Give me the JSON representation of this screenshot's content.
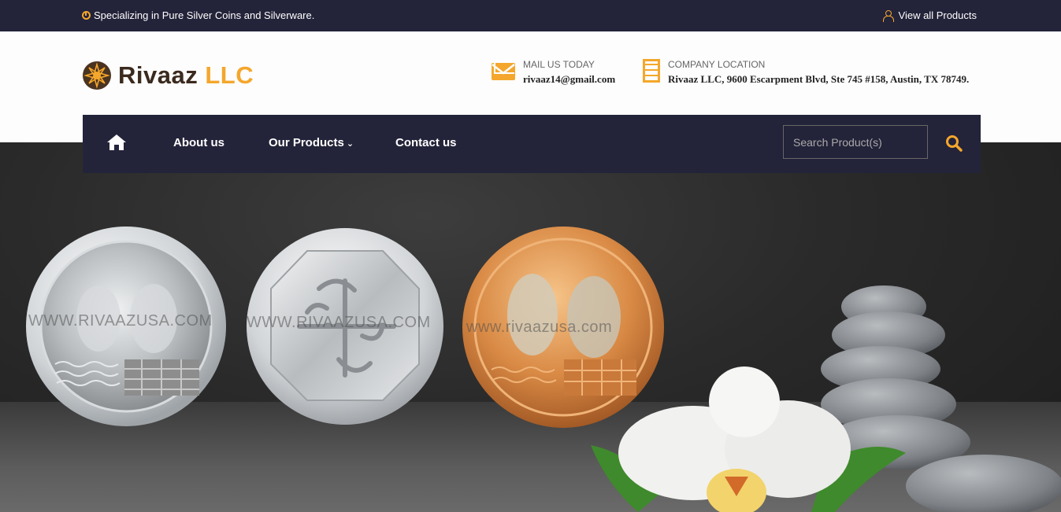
{
  "topbar": {
    "tagline": "Specializing in Pure Silver Coins and Silverware.",
    "view_products": "View all Products"
  },
  "brand": {
    "name_part1": "Rivaaz",
    "name_part2": "LLC"
  },
  "contact": {
    "mail_label": "MAIL US TODAY",
    "mail_value": "rivaaz14@gmail.com",
    "location_label": "COMPANY LOCATION",
    "location_value": "Rivaaz LLC, 9600 Escarpment Blvd, Ste 745 #158, Austin, TX 78749."
  },
  "nav": {
    "items": [
      {
        "label": "About us"
      },
      {
        "label": "Our Products"
      },
      {
        "label": "Contact us"
      }
    ],
    "search_placeholder": "Search Product(s)"
  },
  "hero": {
    "watermarks": [
      "WWW.RIVAAZUSA.COM",
      "WWW.RIVAAZUSA.COM",
      "www.rivaazusa.com"
    ]
  },
  "colors": {
    "accent": "#f4a72c",
    "navy": "#23233a"
  }
}
